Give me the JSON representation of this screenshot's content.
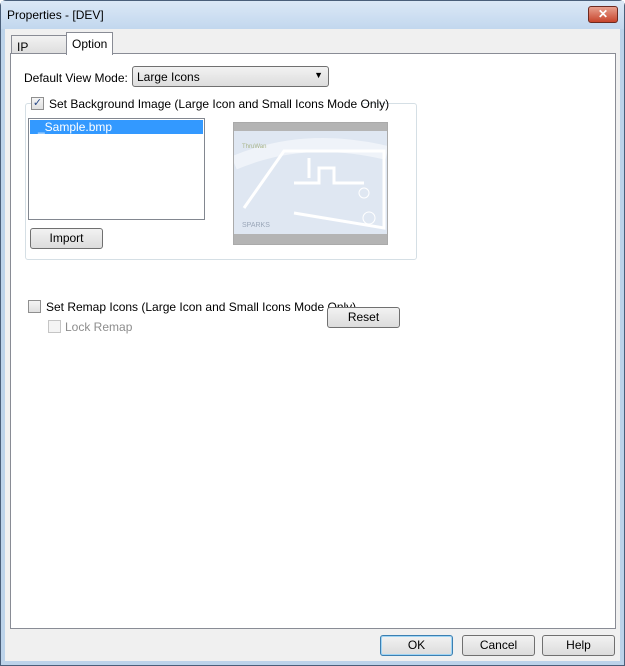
{
  "window": {
    "title": "Properties - [DEV]",
    "close_icon": "close-icon"
  },
  "tabs": [
    {
      "label": "IP Range",
      "active": false
    },
    {
      "label": "Option",
      "active": true
    }
  ],
  "option": {
    "view_mode_label": "Default View Mode:",
    "view_mode_value": "Large Icons",
    "bg_checkbox_label": "Set Background Image (Large Icon and Small Icons Mode Only)",
    "bg_checked": true,
    "files": [
      "_Sample.bmp"
    ],
    "import_label": "Import",
    "remap_label": "Set Remap Icons (Large Icon and Small Icons Mode Only)",
    "remap_checked": false,
    "lock_remap_label": "Lock Remap",
    "lock_remap_checked": false,
    "reset_label": "Reset"
  },
  "footer": {
    "ok": "OK",
    "cancel": "Cancel",
    "help": "Help"
  }
}
